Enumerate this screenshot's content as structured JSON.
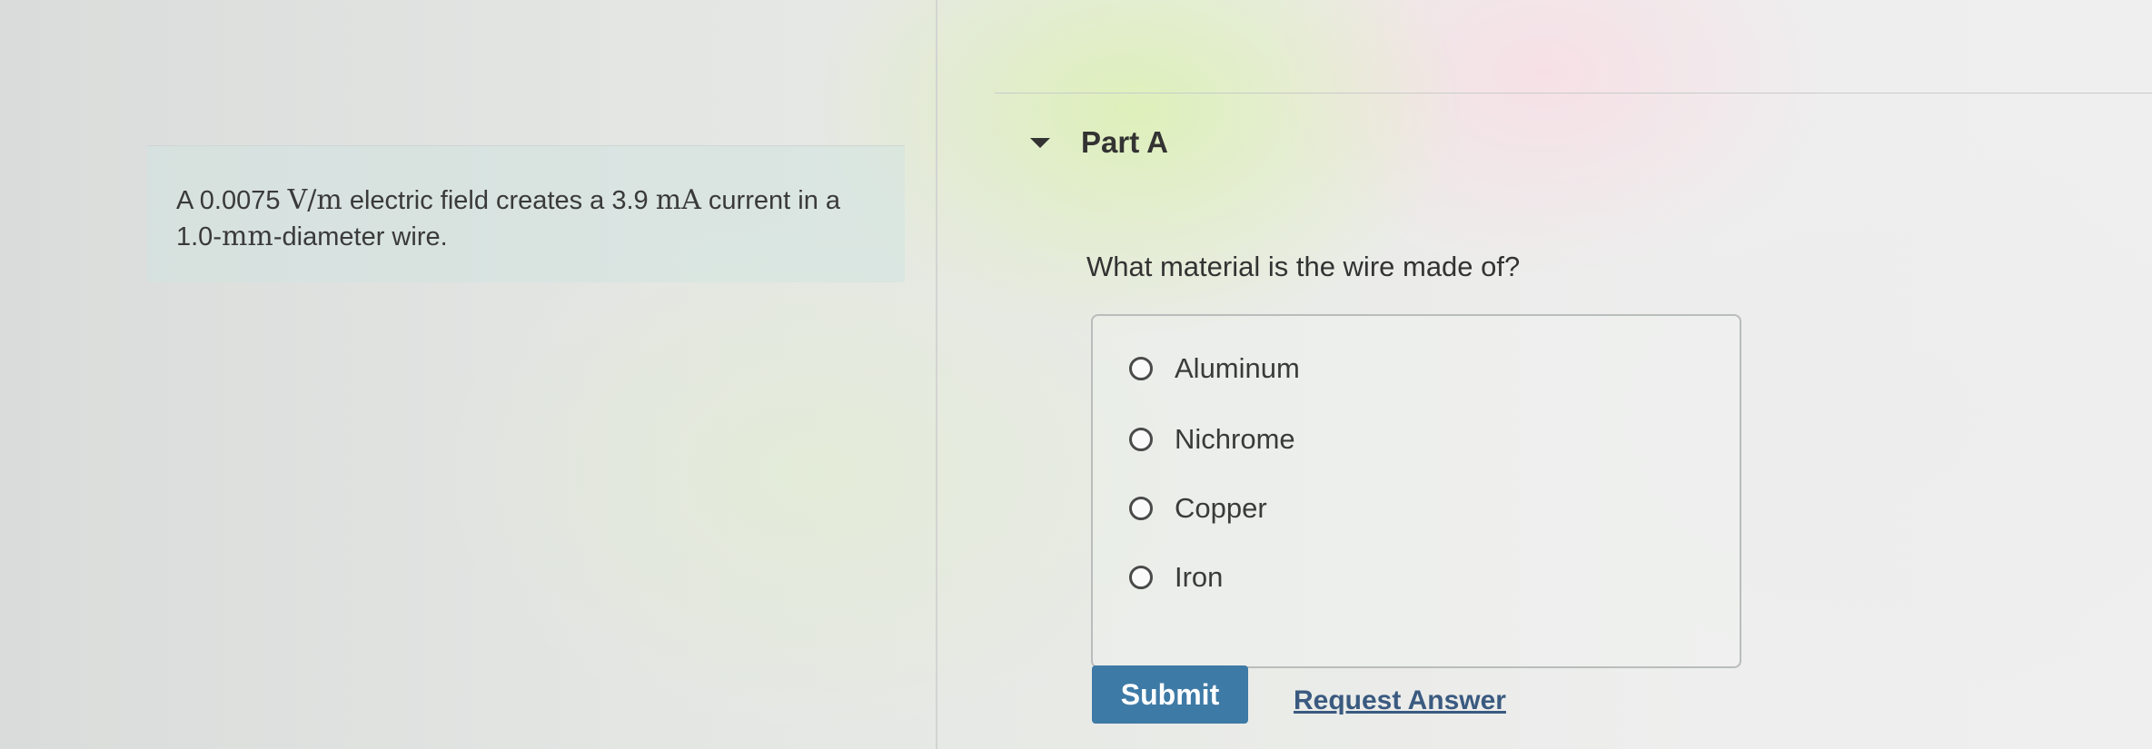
{
  "problem": {
    "text_prefix": "A 0.0075 ",
    "field_unit": "V/m",
    "text_mid1": " electric field creates a 3.9 ",
    "current_unit": "mA",
    "text_mid2": " current in a 1.0-",
    "diameter_unit": "mm",
    "text_suffix": "-diameter wire."
  },
  "part": {
    "title": "Part A",
    "question": "What material is the wire made of?",
    "choices": [
      {
        "label": "Aluminum"
      },
      {
        "label": "Nichrome"
      },
      {
        "label": "Copper"
      },
      {
        "label": "Iron"
      }
    ],
    "submit_label": "Submit",
    "request_label": "Request Answer"
  },
  "colors": {
    "submit_bg": "#3e7aa6",
    "link": "#3a5a80",
    "text": "#333333"
  },
  "icons": {
    "collapse": "caret-down-icon",
    "choice": "radio-empty-icon"
  }
}
